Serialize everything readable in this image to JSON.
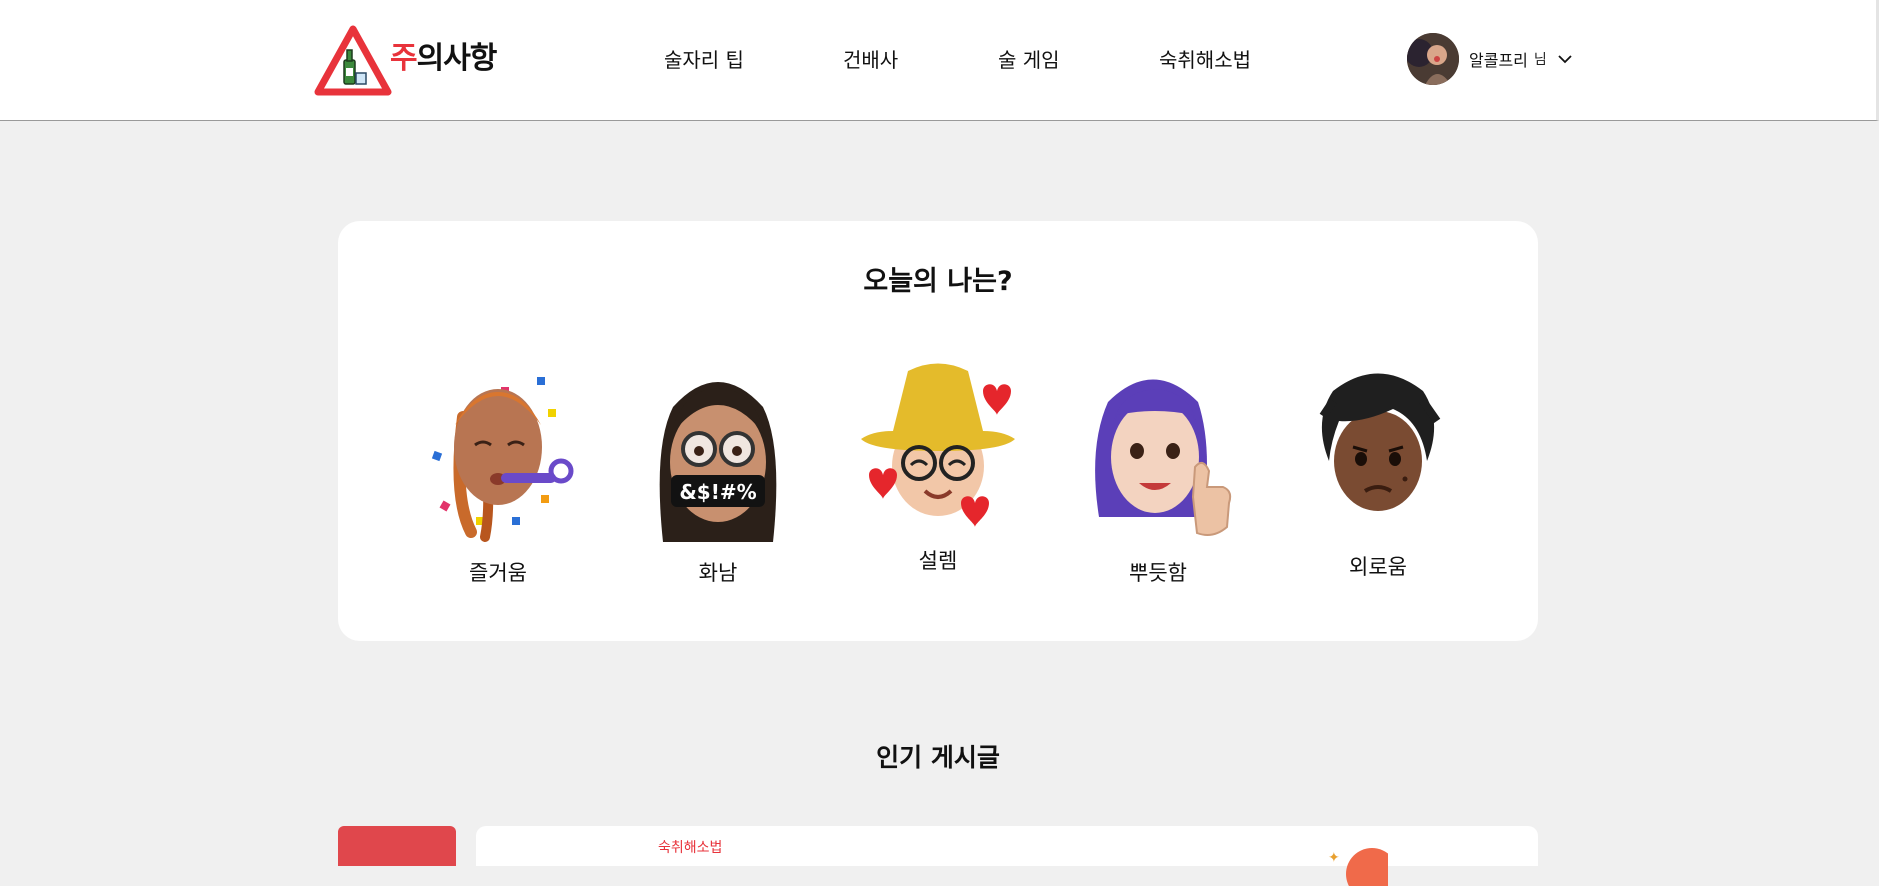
{
  "brand": {
    "logo_accent": "주",
    "logo_rest": "의사항",
    "accent_color": "#e8333b"
  },
  "nav": {
    "items": [
      {
        "label": "술자리 팁"
      },
      {
        "label": "건배사"
      },
      {
        "label": "술 게임"
      },
      {
        "label": "숙취해소법"
      }
    ]
  },
  "user": {
    "name": "알콜프리",
    "suffix": "님",
    "menu_icon": "chevron-down-icon"
  },
  "mood": {
    "title": "오늘의 나는?",
    "items": [
      {
        "label": "즐거움",
        "icon": "party-memoji"
      },
      {
        "label": "화남",
        "icon": "angry-memoji",
        "mouth_text": "&$!#%"
      },
      {
        "label": "설렘",
        "icon": "love-memoji"
      },
      {
        "label": "뿌듯함",
        "icon": "proud-memoji"
      },
      {
        "label": "외로움",
        "icon": "lonely-memoji"
      }
    ]
  },
  "popular": {
    "title": "인기 게시글",
    "posts": [
      {
        "category": "숙취해소법"
      }
    ]
  }
}
